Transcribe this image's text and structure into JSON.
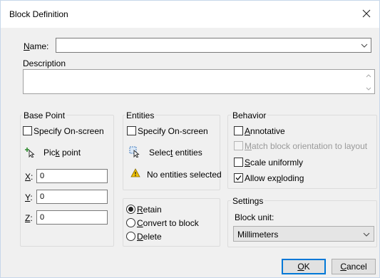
{
  "dialog": {
    "title": "Block Definition"
  },
  "name": {
    "label_hot": "N",
    "label_rest": "ame:",
    "value": ""
  },
  "description": {
    "label": "Description",
    "value": ""
  },
  "base_point": {
    "label": "Base Point",
    "specify_on_screen": {
      "label": "Specify On-screen",
      "checked": false
    },
    "pick_point": {
      "pre": "Pic",
      "hot": "k",
      "post": " point"
    },
    "x": {
      "label": "X",
      "sep": ":",
      "value": "0"
    },
    "y": {
      "label": "Y",
      "sep": ":",
      "value": "0"
    },
    "z": {
      "label": "Z",
      "sep": ":",
      "value": "0"
    }
  },
  "entities": {
    "label": "Entities",
    "specify_on_screen": {
      "label": "Specify On-screen",
      "checked": false
    },
    "select_entities": {
      "pre": "Selec",
      "hot": "t",
      "post": " entities"
    },
    "status": "No entities selected"
  },
  "after_define": {
    "options": [
      {
        "hot": "R",
        "rest": "etain",
        "selected": true
      },
      {
        "hot": "C",
        "rest": "onvert to block",
        "selected": false
      },
      {
        "hot": "D",
        "rest": "elete",
        "selected": false
      }
    ]
  },
  "behavior": {
    "label": "Behavior",
    "annotative": {
      "hot": "A",
      "rest": "nnotative",
      "checked": false
    },
    "match_orientation": {
      "hot": "M",
      "rest": "atch block orientation to layout",
      "checked": false,
      "enabled": false
    },
    "scale_uniformly": {
      "hot": "S",
      "rest": "cale uniformly",
      "checked": false
    },
    "allow_exploding": {
      "pre": "Allow ex",
      "hot": "p",
      "post": "loding",
      "checked": true
    }
  },
  "settings": {
    "label": "Settings",
    "block_unit_label": "Block unit:",
    "block_unit_value": "Millimeters"
  },
  "buttons": {
    "ok": {
      "hot": "O",
      "rest": "K"
    },
    "cancel": {
      "hot": "C",
      "rest": "ancel"
    }
  },
  "colors": {
    "accent": "#0078d7",
    "warning": "#f2c200"
  }
}
